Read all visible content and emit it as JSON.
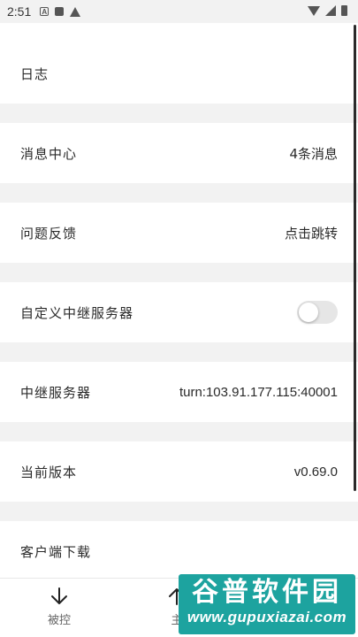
{
  "status_bar": {
    "time": "2:51"
  },
  "settings": {
    "rows": [
      {
        "label": "日志",
        "value": ""
      },
      {
        "label": "消息中心",
        "value": "4条消息"
      },
      {
        "label": "问题反馈",
        "value": "点击跳转"
      },
      {
        "label": "自定义中继服务器",
        "toggle_on": false
      },
      {
        "label": "中继服务器",
        "value": "turn:103.91.177.115:40001"
      },
      {
        "label": "当前版本",
        "value": "v0.69.0"
      },
      {
        "label": "客户端下载",
        "value": ""
      }
    ]
  },
  "bottom_nav": {
    "items": [
      {
        "label": "被控",
        "icon": "arrow-down-icon"
      },
      {
        "label": "主",
        "icon": "arrow-up-icon"
      }
    ]
  },
  "watermark": {
    "title": "谷普软件园",
    "url": "www.gupuxiazai.com"
  },
  "colors": {
    "page_bg": "#f2f2f2",
    "card_bg": "#ffffff",
    "text": "#2a2a2a",
    "toggle_off": "#e6e6e6",
    "watermark_bg": "#1da39f"
  }
}
